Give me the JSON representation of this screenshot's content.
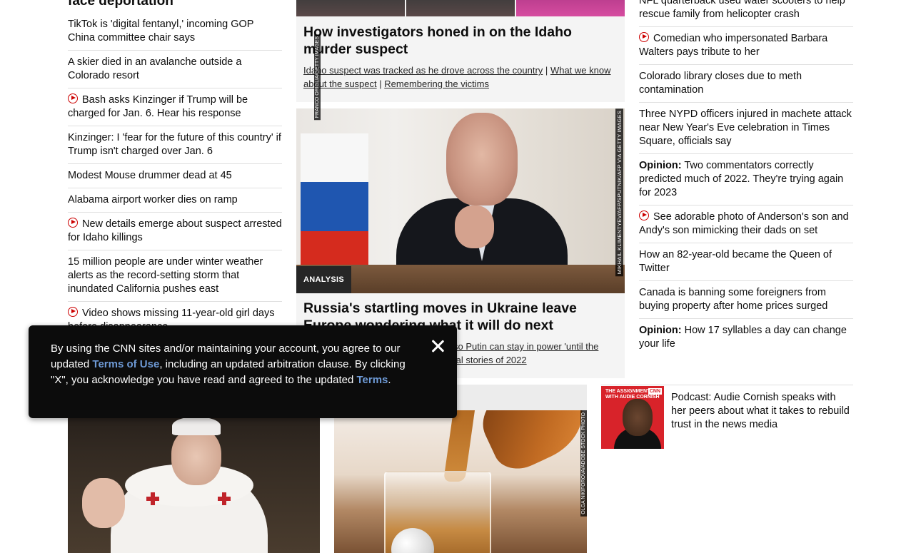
{
  "left_column": {
    "top_headline": "face deportation",
    "items": [
      {
        "text": "TikTok is 'digital fentanyl,' incoming GOP China committee chair says",
        "video": false
      },
      {
        "text": "A skier died in an avalanche outside a Colorado resort",
        "video": false
      },
      {
        "text": "Bash asks Kinzinger if Trump will be charged for Jan. 6. Hear his response",
        "video": true
      },
      {
        "text": "Kinzinger: I 'fear for the future of this country' if Trump isn't charged over Jan. 6",
        "video": false
      },
      {
        "text": "Modest Mouse drummer dead at 45",
        "video": false
      },
      {
        "text": "Alabama airport worker dies on ramp",
        "video": false
      },
      {
        "text": "New details emerge about suspect arrested for Idaho killings",
        "video": true
      },
      {
        "text": "15 million people are under winter weather alerts as the record-setting storm that inundated California pushes east",
        "video": false
      },
      {
        "text": "Video shows missing 11-year-old girl days before disappearance",
        "video": true
      }
    ]
  },
  "middle_column": {
    "idaho_card": {
      "title": "How investigators honed in on the Idaho murder suspect",
      "links": [
        "Idaho suspect was tracked as he drove across the country",
        "What we know about the suspect",
        "Remembering the victims"
      ],
      "separator": "|"
    },
    "putin_card": {
      "credit": "MIKHAIL KLIMENTYEV/AFP/SPUTNIK/AFP VIA GETTY IMAGES",
      "badge": "ANALYSIS",
      "title": "Russia's startling moves in Ukraine leave Europe wondering what it will do next",
      "sub_visible_1": "so Putin can stay in power 'until the",
      "sub_visible_2": "tal stories of 2022"
    }
  },
  "right_column": {
    "items": [
      {
        "label": "",
        "text": "NFL quarterback used water scooters to help rescue family from helicopter crash",
        "video": false
      },
      {
        "label": "",
        "text": "Comedian who impersonated Barbara Walters pays tribute to her",
        "video": true
      },
      {
        "label": "",
        "text": "Colorado library closes due to meth contamination",
        "video": false
      },
      {
        "label": "",
        "text": "Three NYPD officers injured in machete attack near New Year's Eve celebration in Times Square, officials say",
        "video": false
      },
      {
        "label": "Opinion:",
        "text": "Two commentators correctly predicted much of 2022. They're trying again for 2023",
        "video": false
      },
      {
        "label": "",
        "text": "See adorable photo of Anderson's son and Andy's son mimicking their dads on set",
        "video": true
      },
      {
        "label": "",
        "text": "How an 82-year-old became the Queen of Twitter",
        "video": false
      },
      {
        "label": "",
        "text": "Canada is banning some foreigners from buying property after home prices surged",
        "video": false
      },
      {
        "label": "Opinion:",
        "text": "How 17 syllables a day can change your life",
        "video": false
      }
    ]
  },
  "bottom_row": {
    "pope_credit": "FRANCO ORIGLIA/GETTY IMAGES",
    "whisky_credit": "OLGA NIKIFOROVA/ADOBE STOCK PHOTO",
    "podcast": {
      "thumb_label": "THE ASSIGNMENT WITH AUDIE CORNISH",
      "thumb_brand": "CNN",
      "title": "Podcast: Audie Cornish speaks with her peers about what it takes to rebuild trust in the news media"
    }
  },
  "consent_banner": {
    "text_1": "By using the CNN sites and/or maintaining your account, you agree to our updated ",
    "terms_of_use": "Terms of Use",
    "text_2": ", including an updated arbitration clause. By clicking \"X\", you acknowledge you have read and agreed to the updated ",
    "terms": "Terms",
    "text_3": "."
  },
  "colors": {
    "accent_red": "#cc0000",
    "link_blue": "#6e9ad6",
    "banner_bg": "#0c0c0c"
  }
}
